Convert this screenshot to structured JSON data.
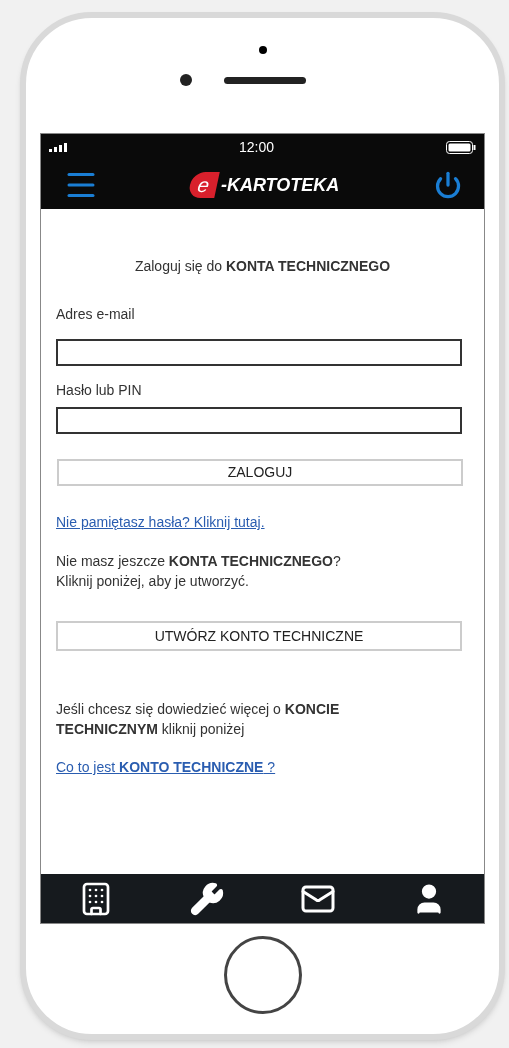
{
  "status_bar": {
    "time": "12:00"
  },
  "header": {
    "logo_mark": "e",
    "logo_text": "-KARTOTEKA"
  },
  "login": {
    "heading": "Zaloguj się do **KONTA TECHNICZNEGO**",
    "fields": [
      {
        "label": "Adres e-mail"
      },
      {
        "label": "Hasło lub PIN"
      }
    ],
    "submit": "ZALOGUJ",
    "forgot_link": "Nie pamiętasz hasła? Kliknij tutaj."
  },
  "register": {
    "text": "Nie masz jeszcze **KONTA TECHNICZNEGO**?\nKliknij poniżej, aby je utworzyć.",
    "button": "UTWÓRZ KONTO TECHNICZNE"
  },
  "info": {
    "text": "Jeśli chcesz się dowiedzieć więcej o **KONCIE TECHNICZNYM** kliknij poniżej",
    "link": "Co to jest **KONTO TECHNICZNE** ?"
  },
  "bottom_nav": [
    {
      "kind": "building"
    },
    {
      "kind": "wrench"
    },
    {
      "kind": "mail"
    },
    {
      "kind": "user"
    }
  ]
}
